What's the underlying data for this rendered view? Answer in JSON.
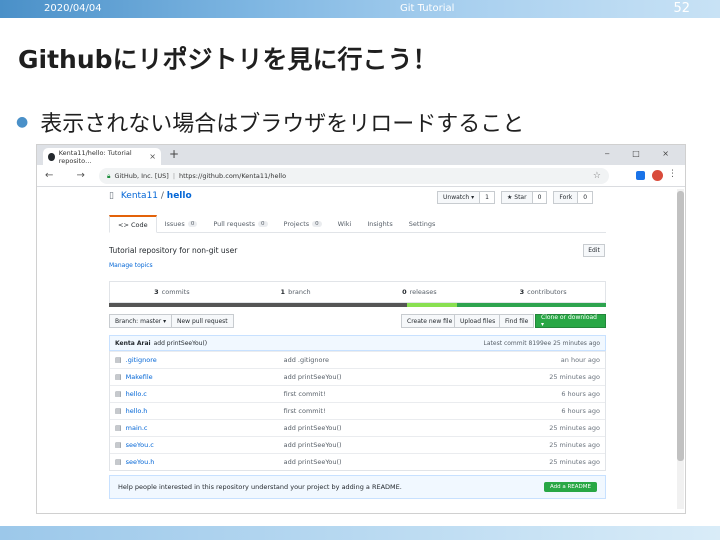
{
  "slide": {
    "date": "2020/04/04",
    "header_title": "Git Tutorial",
    "page_number": "52",
    "title": "Githubにリポジトリを見に行こう！",
    "bullet": "表示されない場合はブラウザをリロードすること"
  },
  "browser": {
    "tab_title": "Kenta11/hello: Tutorial reposito…",
    "tab_close": "×",
    "new_tab": "+",
    "window_controls": "‒ □ ×",
    "nav_buttons": "← → ⟳",
    "url_org": "GitHub, Inc. [US]",
    "url": "https://github.com/Kenta11/hello"
  },
  "repo": {
    "owner": "Kenta11",
    "separator": " / ",
    "name": "hello",
    "unwatch": "Unwatch ▾",
    "watch_count": "1",
    "star": "★ Star",
    "star_count": "0",
    "fork": "Fork",
    "fork_count": "0",
    "tabs": [
      {
        "label": "<> Code",
        "count": ""
      },
      {
        "label": "Issues",
        "count": "0"
      },
      {
        "label": "Pull requests",
        "count": "0"
      },
      {
        "label": "Projects",
        "count": "0"
      },
      {
        "label": "Wiki",
        "count": ""
      },
      {
        "label": "Insights",
        "count": ""
      },
      {
        "label": "Settings",
        "count": ""
      }
    ],
    "description": "Tutorial repository for non-git user",
    "manage_topics": "Manage topics",
    "edit": "Edit",
    "summary": [
      {
        "num": "3",
        "label": "commits"
      },
      {
        "num": "1",
        "label": "branch"
      },
      {
        "num": "0",
        "label": "releases"
      },
      {
        "num": "3",
        "label": "contributors"
      }
    ],
    "lang_colors": [
      "#555555",
      "#555555",
      "#89e051",
      "#2ea44f"
    ],
    "branch_button": "Branch: master ▾",
    "new_pr": "New pull request",
    "create_file": "Create new file",
    "upload": "Upload files",
    "find_file": "Find file",
    "clone": "Clone or download ▾",
    "commit_author": "Kenta Arai",
    "commit_msg": "add printSeeYou()",
    "latest_commit": "Latest commit 8199ee 25 minutes ago",
    "files": [
      {
        "name": ".gitignore",
        "msg": "add .gitignore",
        "age": "an hour ago"
      },
      {
        "name": "Makefile",
        "msg": "add printSeeYou()",
        "age": "25 minutes ago"
      },
      {
        "name": "hello.c",
        "msg": "first commit!",
        "age": "6 hours ago"
      },
      {
        "name": "hello.h",
        "msg": "first commit!",
        "age": "6 hours ago"
      },
      {
        "name": "main.c",
        "msg": "add printSeeYou()",
        "age": "25 minutes ago"
      },
      {
        "name": "seeYou.c",
        "msg": "add printSeeYou()",
        "age": "25 minutes ago"
      },
      {
        "name": "seeYou.h",
        "msg": "add printSeeYou()",
        "age": "25 minutes ago"
      }
    ],
    "readme_prompt": "Help people interested in this repository understand your project by adding a README.",
    "add_readme": "Add a README"
  }
}
